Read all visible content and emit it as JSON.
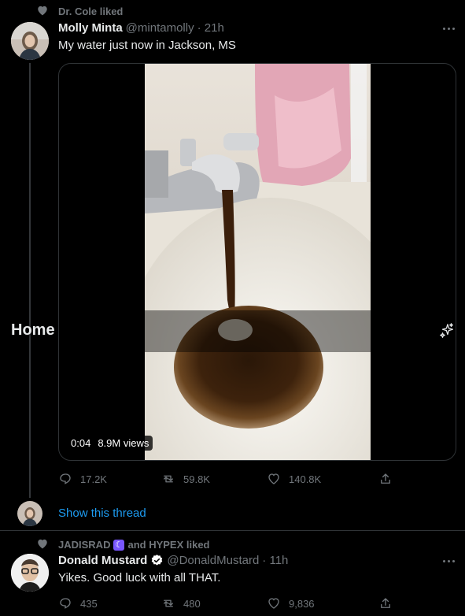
{
  "tweet1": {
    "context": "Dr. Cole liked",
    "author_name": "Molly Minta",
    "author_handle": "@mintamolly",
    "time": "· 21h",
    "text": "My water just now in Jackson, MS",
    "video": {
      "timestamp": "0:04",
      "views": "8.9M views"
    },
    "actions": {
      "replies": "17.2K",
      "retweets": "59.8K",
      "likes": "140.8K"
    },
    "show_thread": "Show this thread"
  },
  "overlay": {
    "home_label": "Home"
  },
  "tweet2": {
    "context_left": "JADISRAD",
    "context_right": "and HYPEX liked",
    "author_name": "Donald Mustard",
    "author_handle": "@DonaldMustard",
    "time": "· 11h",
    "text": "Yikes. Good luck with all THAT.",
    "actions": {
      "replies": "435",
      "retweets": "480",
      "likes": "9,836"
    }
  },
  "colors": {
    "accent": "#1d9bf0",
    "verified": "#ffffff",
    "badge": "#7856ff"
  }
}
